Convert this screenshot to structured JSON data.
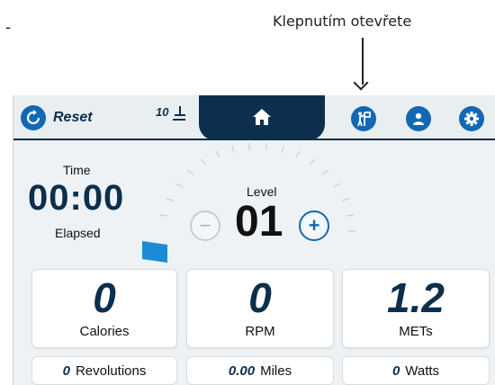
{
  "annotation": {
    "dash": "-",
    "callout_text": "Klepnutím otevřete"
  },
  "topbar": {
    "reset_label": "Reset",
    "incline_number": "10",
    "icons": [
      "reset-icon",
      "incline-icon",
      "home-icon",
      "workout-icon",
      "user-icon",
      "settings-icon"
    ]
  },
  "time": {
    "title": "Time",
    "value": "00:00",
    "subtitle": "Elapsed"
  },
  "level": {
    "title": "Level",
    "value": "01",
    "minus": "−",
    "plus": "+"
  },
  "metrics": [
    {
      "value": "0",
      "label": "Calories"
    },
    {
      "value": "0",
      "label": "RPM"
    },
    {
      "value": "1.2",
      "label": "METs"
    }
  ],
  "secondary": [
    {
      "value": "0",
      "label": "Revolutions"
    },
    {
      "value": "0.00",
      "label": "Miles"
    },
    {
      "value": "0",
      "label": "Watts"
    }
  ],
  "colors": {
    "accent": "#1268b3",
    "navy": "#0b2f4c",
    "bar": "#1b8bd6"
  }
}
